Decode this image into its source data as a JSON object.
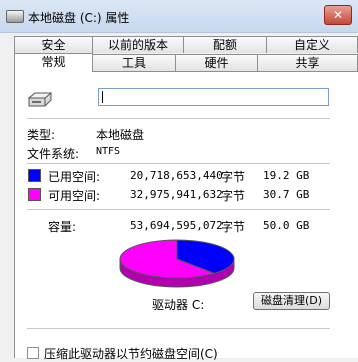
{
  "window": {
    "title": "本地磁盘 (C:) 属性",
    "close_label": "✕"
  },
  "tabs_row1": [
    "安全",
    "以前的版本",
    "配额",
    "自定义"
  ],
  "tabs_row2": [
    "常规",
    "工具",
    "硬件",
    "共享"
  ],
  "active_tab": "常规",
  "general": {
    "name_value": "",
    "type_label": "类型:",
    "type_value": "本地磁盘",
    "fs_label": "文件系统:",
    "fs_value": "NTFS",
    "used": {
      "label": "已用空间:",
      "bytes": "20,718,653,440",
      "unit": "字节",
      "size": "19.2 GB",
      "color": "#0000ff"
    },
    "free": {
      "label": "可用空间:",
      "bytes": "32,975,941,632",
      "unit": "字节",
      "size": "30.7 GB",
      "color": "#ff00ff"
    },
    "capacity": {
      "label": "容量:",
      "bytes": "53,694,595,072",
      "unit": "字节",
      "size": "50.0 GB"
    },
    "drive_label": "驱动器 C:",
    "cleanup_button": "磁盘清理(D)",
    "compress_checkbox": "压缩此驱动器以节约磁盘空间(C)",
    "used_fraction": 0.386
  }
}
